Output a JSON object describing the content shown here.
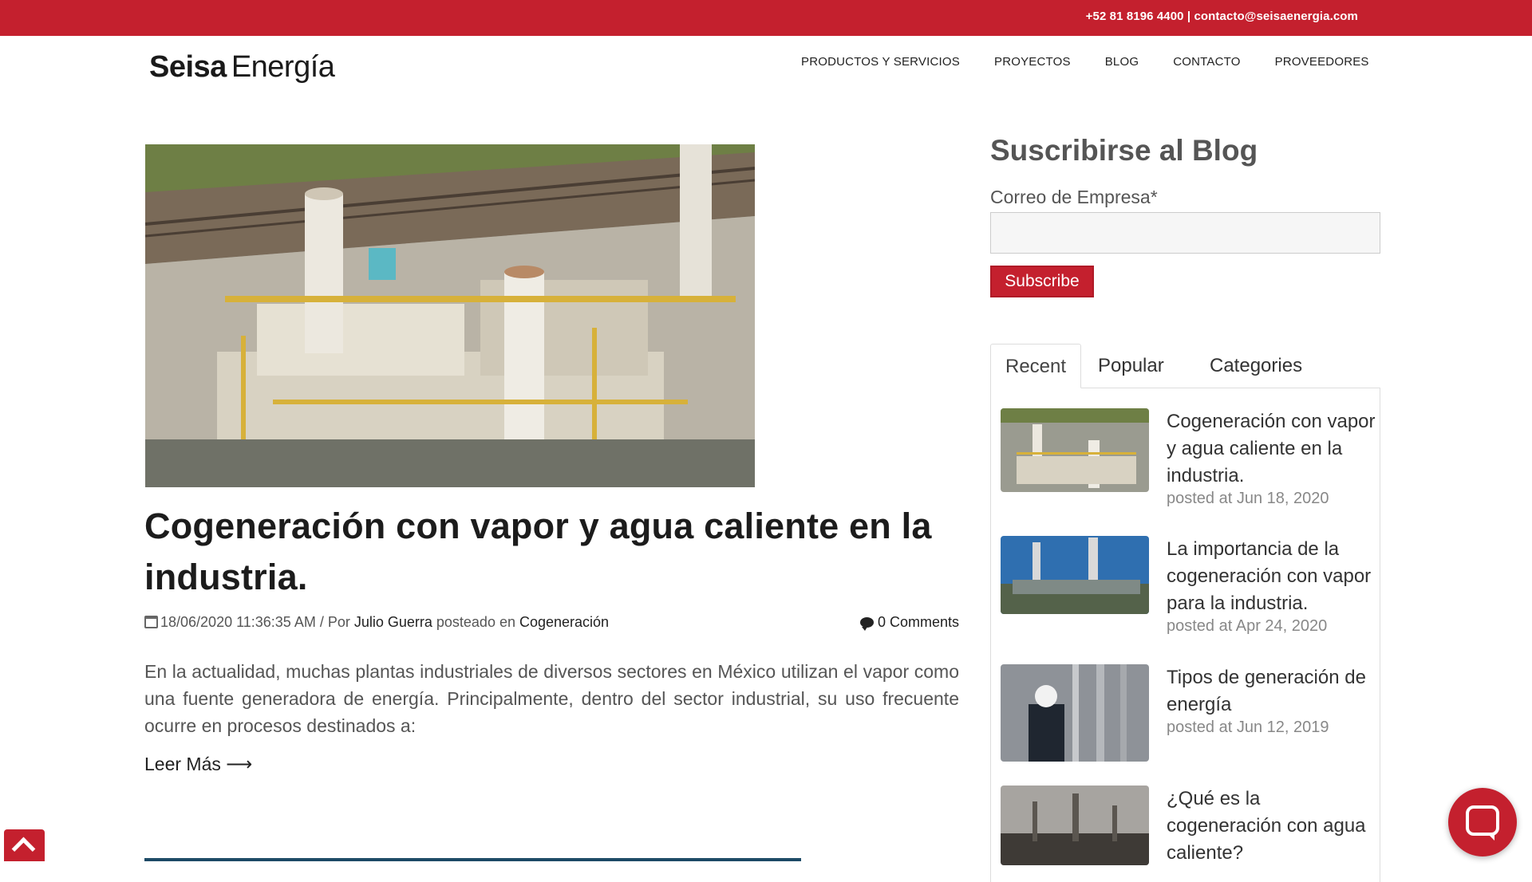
{
  "topbar": {
    "contact": "+52 81 8196 4400 | contacto@seisaenergia.com"
  },
  "header": {
    "logo_bold": "Seisa",
    "logo_light": "Energía",
    "nav": [
      "PRODUCTOS Y SERVICIOS",
      "PROYECTOS",
      "BLOG",
      "CONTACTO",
      "PROVEEDORES"
    ]
  },
  "post": {
    "title": "Cogeneración con vapor y agua caliente en la industria.",
    "date": "18/06/2020 11:36:35 AM",
    "by_label": " / Por ",
    "author": "Julio Guerra",
    "posted_in_label": " posteado en ",
    "category": "Cogeneración",
    "comments": "0 Comments",
    "excerpt": "En la actualidad, muchas plantas industriales de diversos sectores en México utilizan el vapor como una fuente generadora de energía. Principalmente, dentro del sector industrial, su uso frecuente ocurre en procesos destinados a:",
    "read_more": "Leer Más ⟶"
  },
  "sidebar": {
    "title": "Suscribirse al Blog",
    "email_label": "Correo de Empresa*",
    "email_value": "",
    "subscribe": "Subscribe",
    "tabs": [
      "Recent",
      "Popular",
      "Categories"
    ],
    "recent": [
      {
        "title": "Cogeneración con vapor y agua caliente en la industria.",
        "date": "posted at Jun 18, 2020"
      },
      {
        "title": "La importancia de la cogeneración con vapor para la industria.",
        "date": "posted at Apr 24, 2020"
      },
      {
        "title": "Tipos de generación de energía",
        "date": "posted at Jun 12, 2019"
      },
      {
        "title": "¿Qué es la cogeneración con agua caliente?",
        "date": ""
      }
    ]
  },
  "colors": {
    "brand": "#c4202e"
  },
  "icons": {
    "calendar": "calendar-icon",
    "comments": "comment-icon",
    "scroll_top": "chevron-up-icon",
    "chat": "chat-icon"
  }
}
